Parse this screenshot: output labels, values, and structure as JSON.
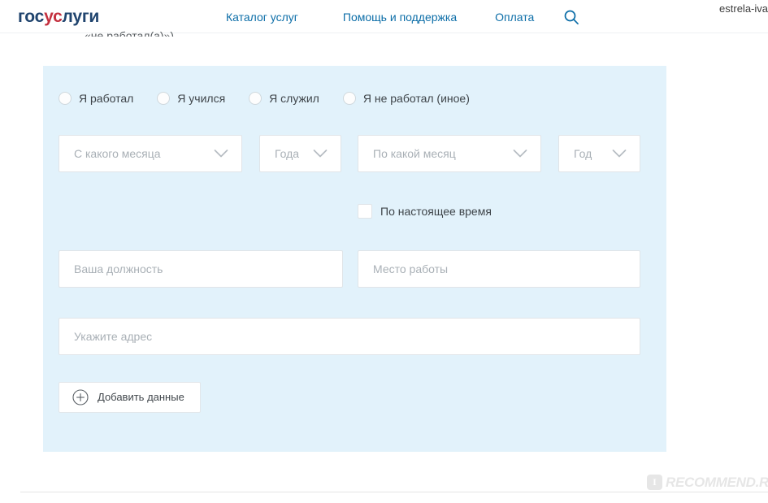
{
  "header": {
    "logo": {
      "part1": "гос",
      "part2": "ус",
      "part3": "луги",
      "full": "госуслуги"
    },
    "nav": [
      {
        "label": "Каталог услуг",
        "name": "nav-catalog"
      },
      {
        "label": "Помощь и поддержка",
        "name": "nav-help"
      },
      {
        "label": "Оплата",
        "name": "nav-payment"
      }
    ],
    "search_icon": "search-icon",
    "user": "estrela-iva",
    "colors": {
      "logo_blue": "#20446e",
      "logo_red": "#c4303f",
      "nav_link": "#0d6ea8"
    }
  },
  "clipped_text": "«не работал(а)»)",
  "form": {
    "panel_color": "#e2f2fb",
    "radio_group": {
      "name": "employment-type",
      "options": [
        {
          "label": "Я работал",
          "selected": false
        },
        {
          "label": "Я учился",
          "selected": false
        },
        {
          "label": "Я служил",
          "selected": false
        },
        {
          "label": "Я не работал (иное)",
          "selected": false
        }
      ]
    },
    "selects": [
      {
        "name": "from-month-select",
        "placeholder": "С какого месяца",
        "value": "",
        "icon": "chevron-down-icon"
      },
      {
        "name": "from-year-select",
        "placeholder": "Года",
        "value": "",
        "icon": "chevron-down-icon"
      },
      {
        "name": "to-month-select",
        "placeholder": "По какой месяц",
        "value": "",
        "icon": "chevron-down-icon"
      },
      {
        "name": "to-year-select",
        "placeholder": "Год",
        "value": "",
        "icon": "chevron-down-icon"
      }
    ],
    "checkbox": {
      "label": "По настоящее время",
      "checked": false
    },
    "inputs": [
      {
        "name": "position-input",
        "placeholder": "Ваша должность",
        "value": ""
      },
      {
        "name": "workplace-input",
        "placeholder": "Место работы",
        "value": ""
      },
      {
        "name": "address-input",
        "placeholder": "Укажите адрес",
        "value": ""
      }
    ],
    "add_button": {
      "label": "Добавить данные",
      "icon": "plus-circle-icon"
    }
  },
  "watermark": {
    "badge": "I",
    "text": "RECOMMEND.RU"
  }
}
